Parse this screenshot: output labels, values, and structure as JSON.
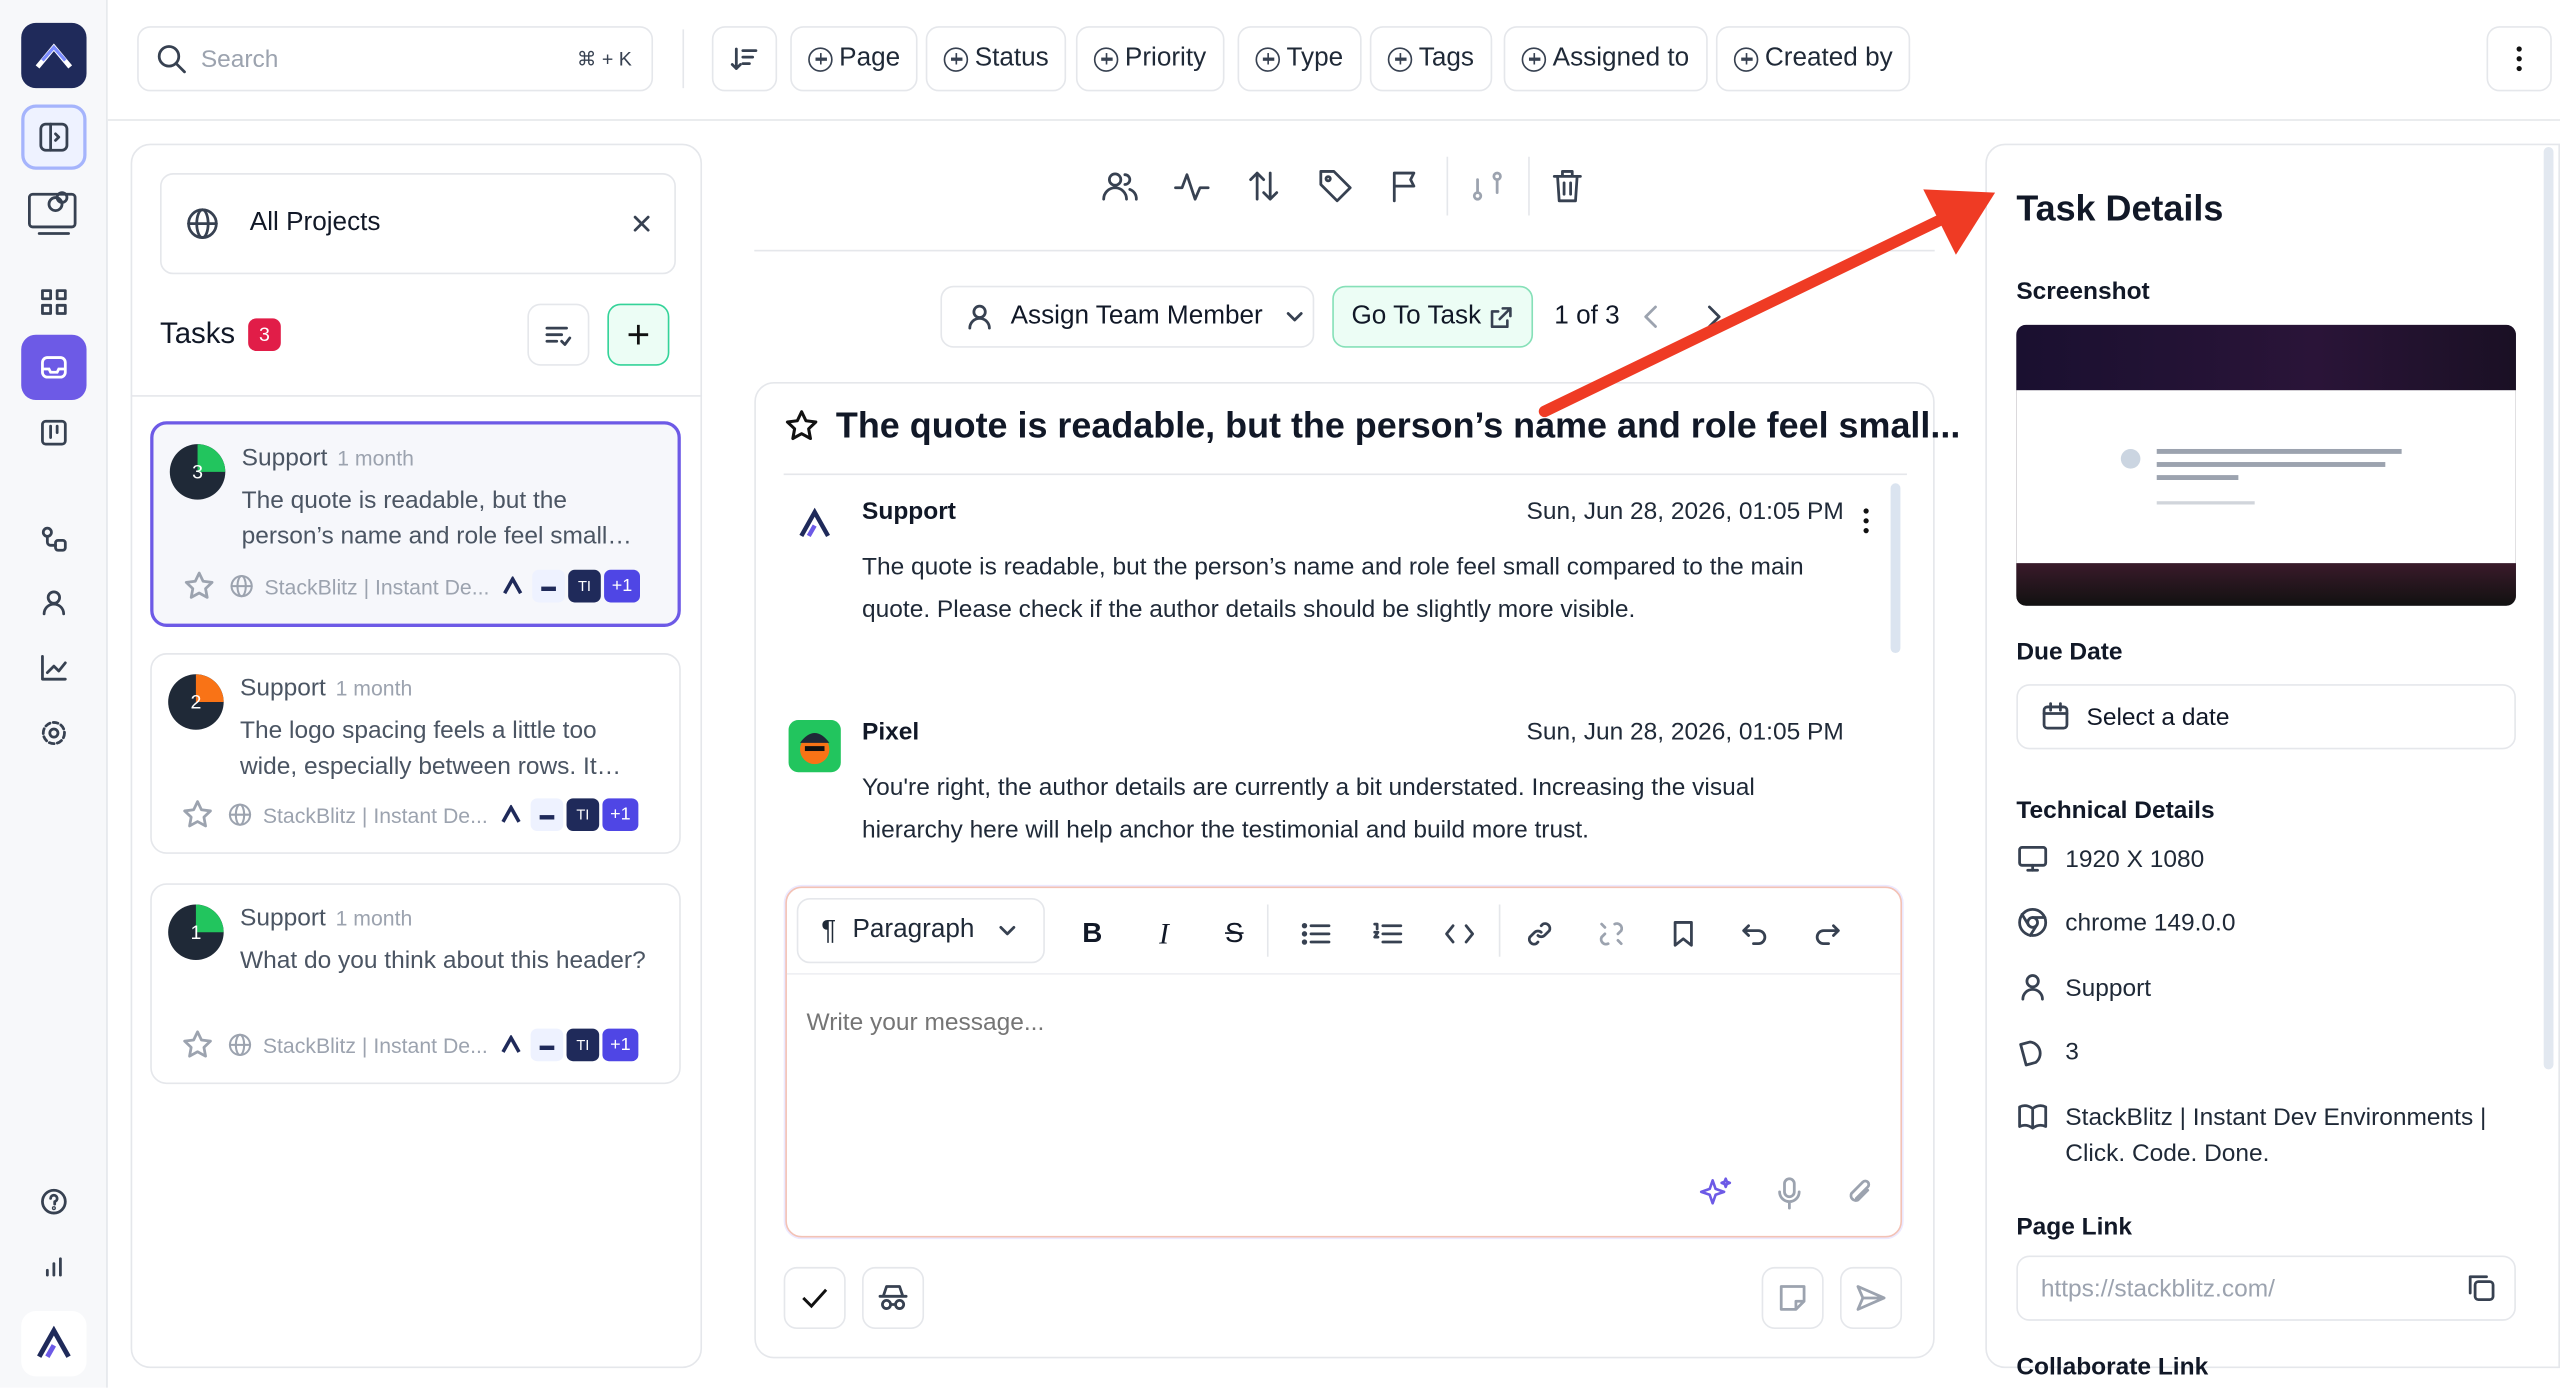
{
  "search": {
    "placeholder": "Search",
    "shortcut": "⌘ + K"
  },
  "filters": [
    "Page",
    "Status",
    "Priority",
    "Type",
    "Tags",
    "Assigned to",
    "Created by"
  ],
  "projects": {
    "label": "All Projects"
  },
  "tasks": {
    "label": "Tasks",
    "count": "3"
  },
  "task_list": [
    {
      "number": "3",
      "category": "Support",
      "age": "1 month",
      "text": "The quote is readable, but the person’s name and role feel small compared to the main quote.",
      "site": "StackBlitz | Instant De...",
      "more": "+1",
      "initials": "TI"
    },
    {
      "number": "2",
      "category": "Support",
      "age": "1 month",
      "text": "The logo spacing feels a little too wide, especially between rows. It makes the section look loose.",
      "site": "StackBlitz | Instant De...",
      "more": "+1",
      "initials": "TI"
    },
    {
      "number": "1",
      "category": "Support",
      "age": "1 month",
      "text": "What do you think about this header?",
      "site": "StackBlitz | Instant De...",
      "more": "+1",
      "initials": "TI"
    }
  ],
  "nav": {
    "assign_label": "Assign Team Member",
    "goto_label": "Go To Task",
    "pager": "1 of 3"
  },
  "thread": {
    "title": "The quote is readable, but the person’s name and role feel small...",
    "messages": [
      {
        "author": "Support",
        "date": "Sun, Jun 28, 2026, 01:05 PM",
        "text": "The quote is readable, but the person’s name and role feel small compared to the main quote. Please check if the author details should be slightly more visible."
      },
      {
        "author": "Pixel",
        "date": "Sun, Jun 28, 2026, 01:05 PM",
        "text": "You're right, the author details are currently a bit understated. Increasing the visual hierarchy here will help anchor the testimonial and build more trust."
      }
    ]
  },
  "editor": {
    "format": "Paragraph",
    "placeholder": "Write your message..."
  },
  "details": {
    "heading": "Task Details",
    "screenshot_label": "Screenshot",
    "due_label": "Due Date",
    "due_value": "Select a date",
    "tech_label": "Technical Details",
    "resolution": "1920 X 1080",
    "browser": "chrome 149.0.0",
    "user": "Support",
    "task_number": "3",
    "page_title": "StackBlitz | Instant Dev Environments | Click. Code. Done.",
    "page_link_label": "Page Link",
    "page_link": "https://stackblitz.com/",
    "next_label": "Collaborate Link"
  },
  "colors": {
    "accent": "#6d5ae6",
    "badge": "#e11d48",
    "goto_bg": "#ecfdf5",
    "arrow": "#ef3b24"
  }
}
